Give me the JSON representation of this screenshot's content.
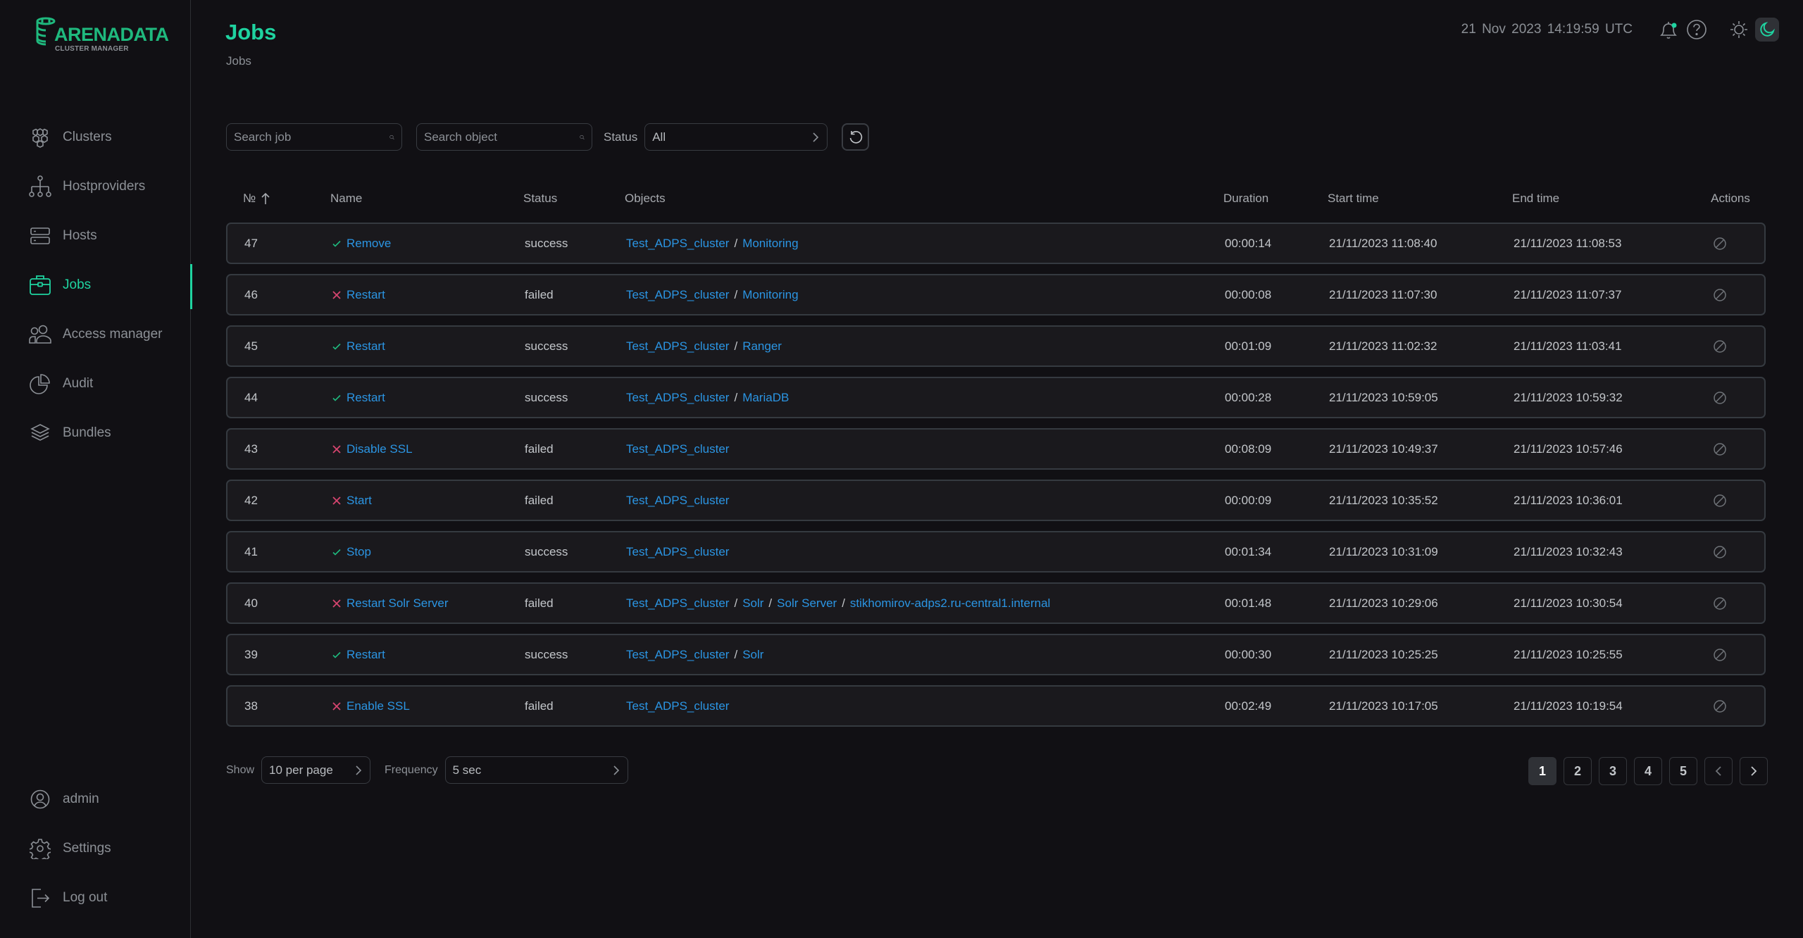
{
  "app": {
    "logo_title": "ARENADATA",
    "logo_subtitle": "CLUSTER MANAGER",
    "accent_color": "#1fd3a0",
    "link_color": "#2b95e3",
    "success_color": "#1fb97e",
    "failed_color": "#d6456f"
  },
  "sidebar": {
    "items": [
      {
        "label": "Clusters",
        "icon": "clusters-icon"
      },
      {
        "label": "Hostproviders",
        "icon": "hostproviders-icon"
      },
      {
        "label": "Hosts",
        "icon": "hosts-icon"
      },
      {
        "label": "Jobs",
        "icon": "jobs-icon",
        "active": true
      },
      {
        "label": "Access manager",
        "icon": "access-manager-icon"
      },
      {
        "label": "Audit",
        "icon": "audit-icon"
      },
      {
        "label": "Bundles",
        "icon": "bundles-icon"
      }
    ],
    "bottom": [
      {
        "label": "admin",
        "icon": "user-icon"
      },
      {
        "label": "Settings",
        "icon": "gear-icon"
      },
      {
        "label": "Log out",
        "icon": "logout-icon"
      }
    ]
  },
  "header": {
    "title": "Jobs",
    "breadcrumb": "Jobs",
    "date": "21 Nov 2023",
    "time": "14:19:59",
    "timezone": "UTC"
  },
  "filters": {
    "search_job_placeholder": "Search job",
    "search_object_placeholder": "Search object",
    "status_label": "Status",
    "status_value": "All"
  },
  "table": {
    "columns": {
      "id": "№",
      "name": "Name",
      "status": "Status",
      "objects": "Objects",
      "duration": "Duration",
      "start": "Start time",
      "end": "End time",
      "actions": "Actions"
    },
    "rows": [
      {
        "id": "47",
        "name": "Remove",
        "status": "success",
        "objects": [
          "Test_ADPS_cluster",
          "Monitoring"
        ],
        "duration": "00:00:14",
        "start": "21/11/2023 11:08:40",
        "end": "21/11/2023 11:08:53"
      },
      {
        "id": "46",
        "name": "Restart",
        "status": "failed",
        "objects": [
          "Test_ADPS_cluster",
          "Monitoring"
        ],
        "duration": "00:00:08",
        "start": "21/11/2023 11:07:30",
        "end": "21/11/2023 11:07:37"
      },
      {
        "id": "45",
        "name": "Restart",
        "status": "success",
        "objects": [
          "Test_ADPS_cluster",
          "Ranger"
        ],
        "duration": "00:01:09",
        "start": "21/11/2023 11:02:32",
        "end": "21/11/2023 11:03:41"
      },
      {
        "id": "44",
        "name": "Restart",
        "status": "success",
        "objects": [
          "Test_ADPS_cluster",
          "MariaDB"
        ],
        "duration": "00:00:28",
        "start": "21/11/2023 10:59:05",
        "end": "21/11/2023 10:59:32"
      },
      {
        "id": "43",
        "name": "Disable SSL",
        "status": "failed",
        "objects": [
          "Test_ADPS_cluster"
        ],
        "duration": "00:08:09",
        "start": "21/11/2023 10:49:37",
        "end": "21/11/2023 10:57:46"
      },
      {
        "id": "42",
        "name": "Start",
        "status": "failed",
        "objects": [
          "Test_ADPS_cluster"
        ],
        "duration": "00:00:09",
        "start": "21/11/2023 10:35:52",
        "end": "21/11/2023 10:36:01"
      },
      {
        "id": "41",
        "name": "Stop",
        "status": "success",
        "objects": [
          "Test_ADPS_cluster"
        ],
        "duration": "00:01:34",
        "start": "21/11/2023 10:31:09",
        "end": "21/11/2023 10:32:43"
      },
      {
        "id": "40",
        "name": "Restart Solr Server",
        "status": "failed",
        "objects": [
          "Test_ADPS_cluster",
          "Solr",
          "Solr Server",
          "stikhomirov-adps2.ru-central1.internal"
        ],
        "duration": "00:01:48",
        "start": "21/11/2023 10:29:06",
        "end": "21/11/2023 10:30:54"
      },
      {
        "id": "39",
        "name": "Restart",
        "status": "success",
        "objects": [
          "Test_ADPS_cluster",
          "Solr"
        ],
        "duration": "00:00:30",
        "start": "21/11/2023 10:25:25",
        "end": "21/11/2023 10:25:55"
      },
      {
        "id": "38",
        "name": "Enable SSL",
        "status": "failed",
        "objects": [
          "Test_ADPS_cluster"
        ],
        "duration": "00:02:49",
        "start": "21/11/2023 10:17:05",
        "end": "21/11/2023 10:19:54"
      }
    ]
  },
  "footer": {
    "show_label": "Show",
    "per_page_value": "10 per page",
    "frequency_label": "Frequency",
    "frequency_value": "5 sec",
    "pages": [
      "1",
      "2",
      "3",
      "4",
      "5"
    ],
    "current_page": "1"
  }
}
